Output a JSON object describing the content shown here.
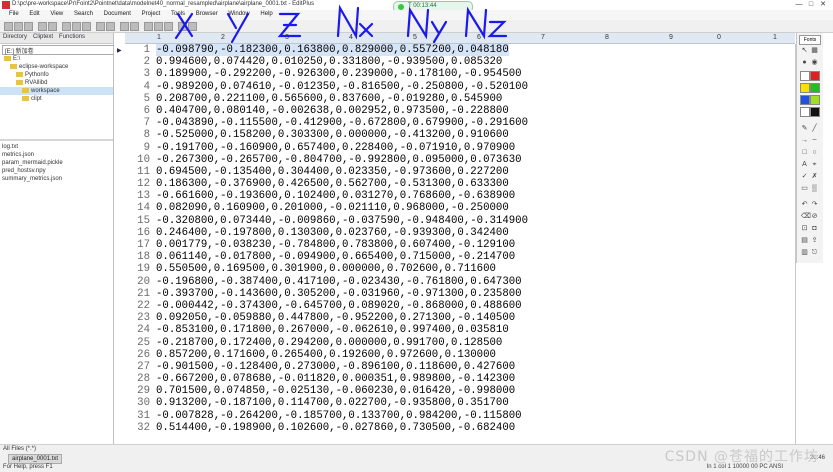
{
  "window": {
    "title": "D:\\pc\\pre-workspace\\Pr\\Foint2\\Pointnet\\data\\modelnet40_normal_resampled\\airplane\\airplane_0001.txt - EditPlus",
    "minimize": "—",
    "maximize": "□",
    "close": "✕"
  },
  "recorder": {
    "label": "T 00:13:44"
  },
  "menu": [
    "File",
    "Edit",
    "View",
    "Search",
    "Document",
    "Project",
    "Tools",
    "Browser",
    "Window",
    "Help"
  ],
  "left_panel": {
    "tabs": [
      "Directory",
      "Cliptext",
      "Functions"
    ],
    "drive": "[E:] 新加卷",
    "tree": [
      {
        "label": "E:\\",
        "selected": false
      },
      {
        "label": "eclipse-workspace",
        "selected": false
      },
      {
        "label": "Pythonfo",
        "selected": false
      },
      {
        "label": "RVAllibd",
        "selected": false
      },
      {
        "label": "workspace",
        "selected": true
      },
      {
        "label": "clipt",
        "selected": false
      }
    ],
    "files": [
      "log.txt",
      "metrics.json",
      "param_mermaid.pickle",
      "pred_hostsv.npy",
      "summary_metrics.json"
    ]
  },
  "ruler": {
    "marks": [
      "1",
      "2",
      "3",
      "4",
      "5",
      "6",
      "7",
      "8",
      "9",
      "0",
      "1"
    ]
  },
  "annotations": [
    "x",
    "y",
    "z",
    "Nx",
    "Ny",
    "Nz"
  ],
  "editor": {
    "lines": [
      {
        "n": "1",
        "text": "-0.098790,-0.182300,0.163800,0.829000,0.557200,0.048180"
      },
      {
        "n": "2",
        "text": "0.994600,0.074420,0.010250,0.331800,-0.939500,0.085320"
      },
      {
        "n": "3",
        "text": "0.189900,-0.292200,-0.926300,0.239000,-0.178100,-0.954500"
      },
      {
        "n": "4",
        "text": "-0.989200,0.074610,-0.012350,-0.816500,-0.250800,-0.520100"
      },
      {
        "n": "5",
        "text": "0.208700,0.221100,0.565600,0.837600,-0.019280,0.545900"
      },
      {
        "n": "6",
        "text": "0.404700,0.080140,-0.002638,0.002952,0.973500,-0.228800"
      },
      {
        "n": "7",
        "text": "-0.043890,-0.115500,-0.412900,-0.672800,0.679900,-0.291600"
      },
      {
        "n": "8",
        "text": "-0.525000,0.158200,0.303300,0.000000,-0.413200,0.910600"
      },
      {
        "n": "9",
        "text": "-0.191700,-0.160900,0.657400,0.228400,-0.071910,0.970900"
      },
      {
        "n": "10",
        "text": "-0.267300,-0.265700,-0.804700,-0.992800,0.095000,0.073630"
      },
      {
        "n": "11",
        "text": "0.694500,-0.135400,0.304400,0.023350,-0.973600,0.227200"
      },
      {
        "n": "12",
        "text": "0.186300,-0.376900,0.426500,0.562700,-0.531300,0.633300"
      },
      {
        "n": "13",
        "text": "-0.661600,-0.193600,0.102400,0.031270,0.768600,-0.638900"
      },
      {
        "n": "14",
        "text": "0.082090,0.160900,0.201000,-0.021110,0.968000,-0.250000"
      },
      {
        "n": "15",
        "text": "-0.320800,0.073440,-0.009860,-0.037590,-0.948400,-0.314900"
      },
      {
        "n": "16",
        "text": "0.246400,-0.197800,0.130300,0.023760,-0.939300,0.342400"
      },
      {
        "n": "17",
        "text": "0.001779,-0.038230,-0.784800,0.783800,0.607400,-0.129100"
      },
      {
        "n": "18",
        "text": "0.061140,-0.017800,-0.094900,0.665400,0.715000,-0.214700"
      },
      {
        "n": "19",
        "text": "0.550500,0.169500,0.301900,0.000000,0.702600,0.711600"
      },
      {
        "n": "20",
        "text": "-0.196800,-0.387400,0.417100,-0.023430,-0.761800,0.647300"
      },
      {
        "n": "21",
        "text": "-0.393700,-0.143600,0.305200,-0.031960,-0.971300,0.235800"
      },
      {
        "n": "22",
        "text": "-0.000442,-0.374300,-0.645700,0.089020,-0.868000,0.488600"
      },
      {
        "n": "23",
        "text": "0.092050,-0.059880,0.447800,-0.952200,0.271300,-0.140500"
      },
      {
        "n": "24",
        "text": "-0.853100,0.171800,0.267000,-0.062610,0.997400,0.035810"
      },
      {
        "n": "25",
        "text": "-0.218700,0.172400,0.294200,0.000000,0.991700,0.128500"
      },
      {
        "n": "26",
        "text": "0.857200,0.171600,0.265400,0.192600,0.972600,0.130000"
      },
      {
        "n": "27",
        "text": "-0.901500,-0.128400,0.273000,-0.896100,0.118600,0.427600"
      },
      {
        "n": "28",
        "text": "-0.667200,0.078680,-0.011820,0.000351,0.989800,-0.142300"
      },
      {
        "n": "29",
        "text": "0.701500,0.074850,-0.025130,-0.060230,0.016420,-0.998000"
      },
      {
        "n": "30",
        "text": "0.913200,-0.187100,0.114700,0.022700,-0.935800,0.351700"
      },
      {
        "n": "31",
        "text": "-0.007828,-0.264200,-0.185700,0.133700,0.984200,-0.115800"
      },
      {
        "n": "32",
        "text": "0.514400,-0.198900,0.102600,-0.027860,0.730500,-0.682400"
      }
    ]
  },
  "right_panel": {
    "top_label": "Fonts"
  },
  "statusbar": {
    "top": "All Files (*.*)",
    "tab": "airplane_0001.txt",
    "help": "For Help, press F1",
    "right": "In 1    col 1    10000   00   PC   ANSI",
    "clock": "20:46"
  },
  "watermark": "CSDN @苍福的工作坊",
  "colors": {
    "annotation": "#1a1aee",
    "current_line": "#d6e4f7",
    "ruler": "#dfe8f3"
  }
}
